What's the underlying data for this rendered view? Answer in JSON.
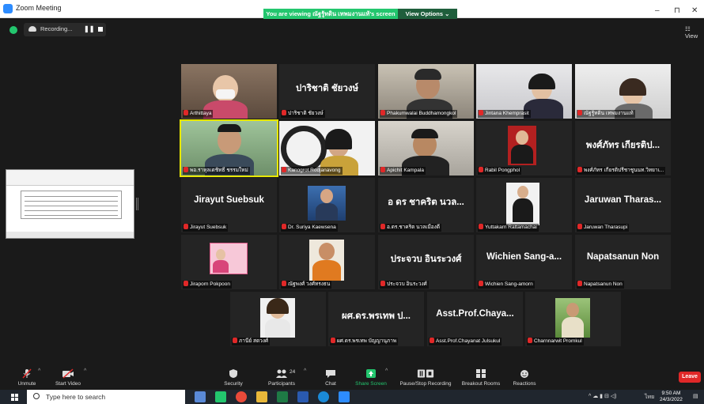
{
  "window": {
    "title": "Zoom Meeting"
  },
  "banner": {
    "viewing": "You are viewing ณัฐรู้ทดิน เทพมงานแท้'s screen",
    "view_options": "View Options ⌄"
  },
  "window_controls": {
    "minimize": "–",
    "restore": "⊓",
    "close": "✕"
  },
  "recording": {
    "text": "Recording...",
    "pause": "❚❚"
  },
  "view_button": "☷ View",
  "tiles": [
    {
      "label": "Arthittaya",
      "big": ""
    },
    {
      "label": "ปาริชาติ ชัยวงษ์",
      "big": "ปาริชาติ ชัยวงษ์"
    },
    {
      "label": "Phakumwalai Buddhamongkol",
      "big": ""
    },
    {
      "label": "Jintana Khemprasit",
      "big": ""
    },
    {
      "label": "ณัฐรู้ทดิน เทพมงานแท้",
      "big": ""
    },
    {
      "label": "พอ.ราหุลเดชิทธิ์ ชรรมใหม่",
      "big": ""
    },
    {
      "label": "Kanogrot Rodjanavong",
      "big": ""
    },
    {
      "label": "Apichit Kampala",
      "big": ""
    },
    {
      "label": "Rabil Pongphol",
      "big": ""
    },
    {
      "label": "พงศ์ภัทร เกียรติปรีชาชูนนท.วิทยาเ...",
      "big": "พงศ์ภัทร เกียรติป..."
    },
    {
      "label": "Jirayut Suebsuk",
      "big": "Jirayut Suebsuk"
    },
    {
      "label": "Dr. Suriya Kaewsena",
      "big": ""
    },
    {
      "label": "อ.ดร.ชาคริต นวลเมืองดี",
      "big": "อ ดร ชาคริต นวล..."
    },
    {
      "label": "Yuttakarn Rattamachai",
      "big": ""
    },
    {
      "label": "Jaruwan Tharasupi",
      "big": "Jaruwan  Tharas..."
    },
    {
      "label": "Jiraporn Pokpoon",
      "big": ""
    },
    {
      "label": "ณัฐพงศ์ วงศ์ทรงธน",
      "big": ""
    },
    {
      "label": "ประจวบ อินระวงศ์",
      "big": "ประจวบ อินระวงศ์"
    },
    {
      "label": "Wichien Sang-amorn",
      "big": "Wichien  Sang-a..."
    },
    {
      "label": "Napatsanun Non",
      "big": "Napatsanun Non"
    },
    {
      "label": "ภานีย์ สดวงศ์",
      "big": ""
    },
    {
      "label": "ผศ.ดร.พรเทพ บัญญานุภาพ",
      "big": "ผศ.ดร.พรเทพ ป..."
    },
    {
      "label": "Asst.Prof.Chayanat Julsukul",
      "big": "Asst.Prof.Chaya..."
    },
    {
      "label": "Charnnarwit Promkul",
      "big": ""
    }
  ],
  "toolbar": {
    "unmute": "Unmute",
    "start_video": "Start Video",
    "security": "Security",
    "participants": "Participants",
    "participants_count": "24",
    "chat": "Chat",
    "share_screen": "Share Screen",
    "pause_recording": "Pause/Stop Recording",
    "breakout": "Breakout Rooms",
    "reactions": "Reactions",
    "leave": "Leave"
  },
  "taskbar": {
    "search_placeholder": "Type here to search",
    "time": "9:50 AM",
    "date": "24/3/2022",
    "lang": "ไทย"
  },
  "colors": {
    "accent": "#2d8cff",
    "banner_green": "#23c66e",
    "leave_red": "#e02828",
    "active_speaker": "#e8e800"
  }
}
